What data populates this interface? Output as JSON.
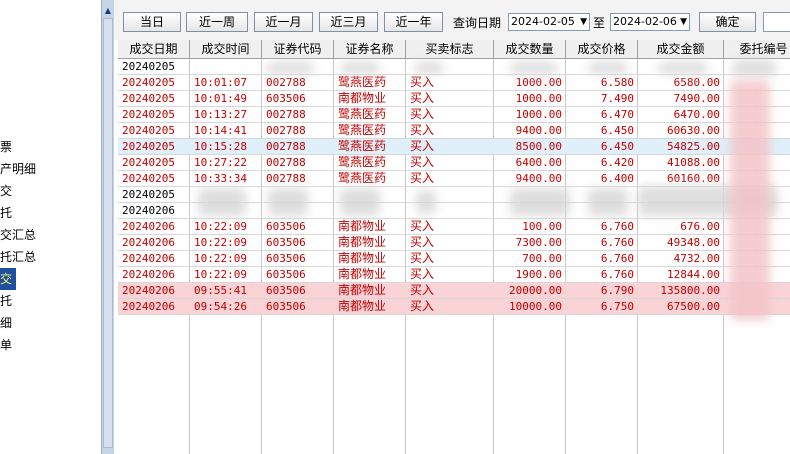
{
  "sidebar": {
    "items": [
      {
        "label": "票",
        "selected": false
      },
      {
        "label": "产明细",
        "selected": false
      },
      {
        "label": "交",
        "selected": false
      },
      {
        "label": "托",
        "selected": false
      },
      {
        "label": "交汇总",
        "selected": false
      },
      {
        "label": "托汇总",
        "selected": false
      },
      {
        "label": "交",
        "selected": true
      },
      {
        "label": "托",
        "selected": false
      },
      {
        "label": "细",
        "selected": false
      },
      {
        "label": "单",
        "selected": false
      }
    ]
  },
  "toolbar": {
    "today_label": "当日",
    "week_label": "近一周",
    "month_label": "近一月",
    "quarter_label": "近三月",
    "year_label": "近一年",
    "query_date_label": "查询日期",
    "start_date": "2024-02-05",
    "to_label": "至",
    "end_date": "2024-02-06",
    "confirm_label": "确定"
  },
  "table": {
    "columns": [
      "成交日期",
      "成交时间",
      "证券代码",
      "证券名称",
      "买卖标志",
      "成交数量",
      "成交价格",
      "成交金额",
      "委托编号"
    ],
    "rows": [
      {
        "date": "20240205",
        "time": "",
        "code": "",
        "name": "",
        "side": "",
        "qty": "",
        "price": "",
        "amount": "",
        "order": "",
        "style": "pending"
      },
      {
        "date": "20240205",
        "time": "10:01:07",
        "code": "002788",
        "name": "鹭燕医药",
        "side": "买入",
        "qty": "1000.00",
        "price": "6.580",
        "amount": "6580.00",
        "order": "",
        "style": "buy"
      },
      {
        "date": "20240205",
        "time": "10:01:49",
        "code": "603506",
        "name": "南都物业",
        "side": "买入",
        "qty": "1000.00",
        "price": "7.490",
        "amount": "7490.00",
        "order": "",
        "style": "buy"
      },
      {
        "date": "20240205",
        "time": "10:13:27",
        "code": "002788",
        "name": "鹭燕医药",
        "side": "买入",
        "qty": "1000.00",
        "price": "6.470",
        "amount": "6470.00",
        "order": "",
        "style": "buy"
      },
      {
        "date": "20240205",
        "time": "10:14:41",
        "code": "002788",
        "name": "鹭燕医药",
        "side": "买入",
        "qty": "9400.00",
        "price": "6.450",
        "amount": "60630.00",
        "order": "",
        "style": "buy"
      },
      {
        "date": "20240205",
        "time": "10:15:28",
        "code": "002788",
        "name": "鹭燕医药",
        "side": "买入",
        "qty": "8500.00",
        "price": "6.450",
        "amount": "54825.00",
        "order": "",
        "style": "buy sel-blue"
      },
      {
        "date": "20240205",
        "time": "10:27:22",
        "code": "002788",
        "name": "鹭燕医药",
        "side": "买入",
        "qty": "6400.00",
        "price": "6.420",
        "amount": "41088.00",
        "order": "",
        "style": "buy"
      },
      {
        "date": "20240205",
        "time": "10:33:34",
        "code": "002788",
        "name": "鹭燕医药",
        "side": "买入",
        "qty": "9400.00",
        "price": "6.400",
        "amount": "60160.00",
        "order": "",
        "style": "buy"
      },
      {
        "date": "20240205",
        "time": "",
        "code": "",
        "name": "",
        "side": "",
        "qty": "",
        "price": "",
        "amount": "",
        "order": "",
        "style": "pending"
      },
      {
        "date": "20240206",
        "time": "",
        "code": "",
        "name": "",
        "side": "",
        "qty": "",
        "price": "",
        "amount": "",
        "order": "",
        "style": "pending"
      },
      {
        "date": "20240206",
        "time": "10:22:09",
        "code": "603506",
        "name": "南都物业",
        "side": "买入",
        "qty": "100.00",
        "price": "6.760",
        "amount": "676.00",
        "order": "",
        "style": "buy"
      },
      {
        "date": "20240206",
        "time": "10:22:09",
        "code": "603506",
        "name": "南都物业",
        "side": "买入",
        "qty": "7300.00",
        "price": "6.760",
        "amount": "49348.00",
        "order": "",
        "style": "buy"
      },
      {
        "date": "20240206",
        "time": "10:22:09",
        "code": "603506",
        "name": "南都物业",
        "side": "买入",
        "qty": "700.00",
        "price": "6.760",
        "amount": "4732.00",
        "order": "",
        "style": "buy"
      },
      {
        "date": "20240206",
        "time": "10:22:09",
        "code": "603506",
        "name": "南都物业",
        "side": "买入",
        "qty": "1900.00",
        "price": "6.760",
        "amount": "12844.00",
        "order": "",
        "style": "buy"
      },
      {
        "date": "20240206",
        "time": "09:55:41",
        "code": "603506",
        "name": "南都物业",
        "side": "买入",
        "qty": "20000.00",
        "price": "6.790",
        "amount": "135800.00",
        "order": "",
        "style": "buy sel-red"
      },
      {
        "date": "20240206",
        "time": "09:54:26",
        "code": "603506",
        "name": "南都物业",
        "side": "买入",
        "qty": "10000.00",
        "price": "6.750",
        "amount": "67500.00",
        "order": "",
        "style": "buy sel-red"
      }
    ]
  },
  "colors": {
    "buy_text": "#c00000",
    "selected_blue_row": "#dff0fa",
    "selected_red_row": "#f9d3d6",
    "sidebar_selected_bg": "#1e4fa3",
    "sidebar_selected_text": "#ffff66"
  }
}
